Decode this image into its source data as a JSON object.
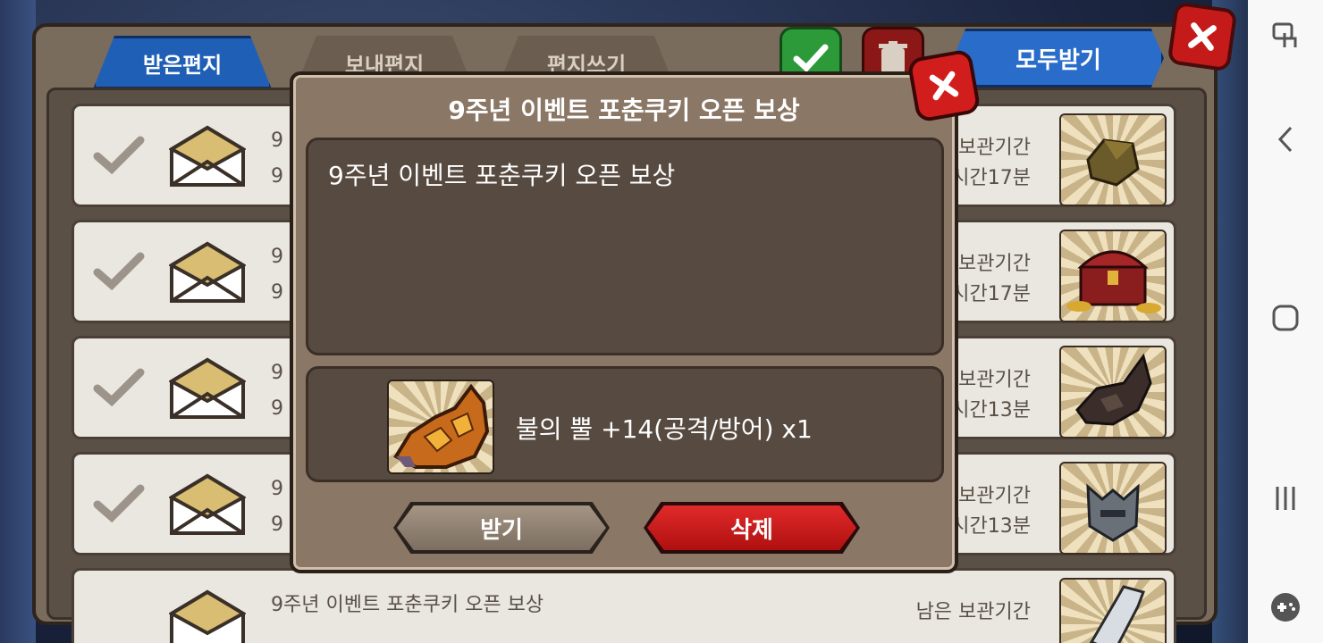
{
  "mailbox": {
    "tabs": [
      {
        "label": "받은편지"
      },
      {
        "label": "보내편지"
      },
      {
        "label": "편지쓰기"
      }
    ],
    "receive_all_label": "모두받기",
    "rows": [
      {
        "line1": "9",
        "line2": "9",
        "expiry1": "보관기간",
        "expiry2": "시간17분",
        "thumb": "gold-chunk-icon"
      },
      {
        "line1": "9",
        "line2": "9",
        "expiry1": "보관기간",
        "expiry2": "시간17분",
        "thumb": "treasure-chest-icon"
      },
      {
        "line1": "9",
        "line2": "9",
        "expiry1": "보관기간",
        "expiry2": "시간13분",
        "thumb": "dark-horn-icon"
      },
      {
        "line1": "9",
        "line2": "9",
        "expiry1": "보관기간",
        "expiry2": "시간13분",
        "thumb": "helmet-icon"
      },
      {
        "line1": "9주년 이벤트 포춘쿠키 오픈 보상",
        "line2": "",
        "expiry1": "남은 보관기간",
        "expiry2": "",
        "thumb": "bottle-icon"
      }
    ]
  },
  "modal": {
    "title": "9주년 이벤트 포춘쿠키 오픈 보상",
    "message": "9주년 이벤트 포춘쿠키 오픈 보상",
    "reward": {
      "label": "불의 뿔 +14(공격/방어) x1",
      "icon": "fire-horn-icon"
    },
    "receive_label": "받기",
    "delete_label": "삭제"
  },
  "colors": {
    "tab_active": "#1f5fb5",
    "delete_red": "#c41313",
    "panel": "#8a7766"
  }
}
